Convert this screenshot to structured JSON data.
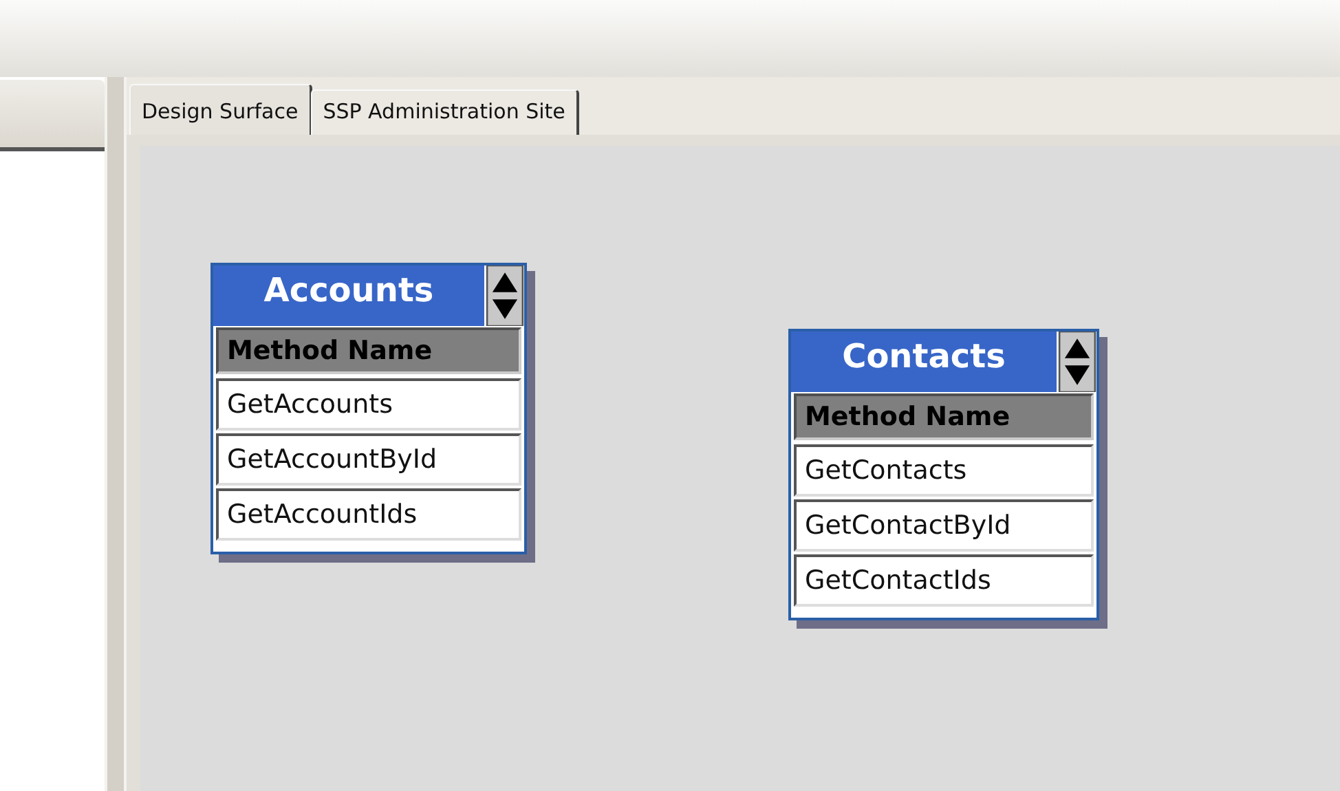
{
  "tabs": [
    {
      "label": "Design Surface",
      "selected": true
    },
    {
      "label": "SSP Administration Site",
      "selected": false
    }
  ],
  "entities": [
    {
      "title": "Accounts",
      "column": "Method Name",
      "methods": [
        "GetAccounts",
        "GetAccountById",
        "GetAccountIds"
      ]
    },
    {
      "title": "Contacts",
      "column": "Method Name",
      "methods": [
        "GetContacts",
        "GetContactById",
        "GetContactIds"
      ]
    }
  ]
}
